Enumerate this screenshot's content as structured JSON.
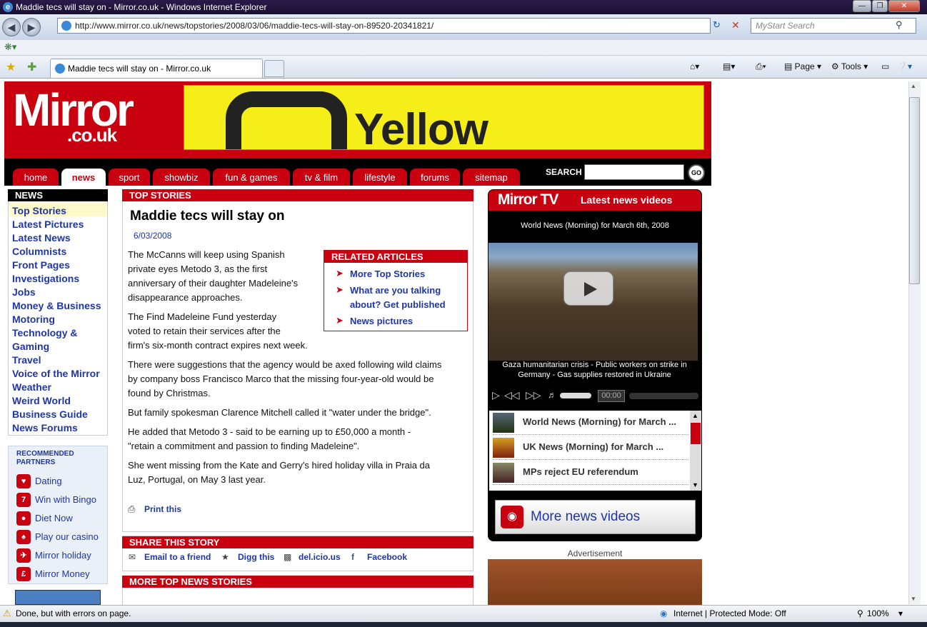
{
  "window": {
    "title": "Maddie tecs will stay on - Mirror.co.uk - Windows Internet Explorer",
    "url": "http://www.mirror.co.uk/news/topstories/2008/03/06/maddie-tecs-will-stay-on-89520-20341821/",
    "search_placeholder": "MyStart Search",
    "tab_title": "Maddie tecs will stay on - Mirror.co.uk",
    "toolbar": {
      "page": "Page",
      "tools": "Tools"
    }
  },
  "header": {
    "logo_main": "Mirror",
    "logo_sub": ".co.uk",
    "ad_text": "Yellow",
    "nav": [
      "home",
      "news",
      "sport",
      "showbiz",
      "fun & games",
      "tv & film",
      "lifestyle",
      "forums",
      "sitemap"
    ],
    "active_nav": "news",
    "search_label": "SEARCH",
    "go_label": "GO"
  },
  "left": {
    "header": "NEWS",
    "items": [
      "Top Stories",
      "Latest Pictures",
      "Latest News",
      "Columnists",
      "Front Pages",
      "Investigations",
      "Jobs",
      "Money & Business",
      "Motoring",
      "Technology &",
      "Gaming",
      "Travel",
      "Voice of the Mirror",
      "Weather",
      "Weird World",
      "Business Guide",
      "News Forums"
    ],
    "recommended_header_1": "RECOMMENDED",
    "recommended_header_2": "PARTNERS",
    "partners": [
      "Dating",
      "Win with Bingo",
      "Diet Now",
      "Play our casino",
      "Mirror holiday",
      "Mirror Money"
    ]
  },
  "article": {
    "section": "TOP STORIES",
    "title": "Maddie tecs will stay on",
    "date": "6/03/2008",
    "p1": [
      "The McCanns will keep using Spanish",
      "private eyes Metodo 3, as the first",
      "anniversary of their daughter Madeleine's",
      "disappearance approaches."
    ],
    "p2": [
      "The Find Madeleine Fund yesterday",
      "voted to retain their services after the",
      "firm's six-month contract expires next week."
    ],
    "p3": [
      "There were suggestions that the agency would be axed following wild claims",
      "by company boss Francisco Marco that the missing four-year-old would be",
      "found by Christmas."
    ],
    "p4": "But family spokesman Clarence Mitchell called it \"water under the bridge\".",
    "p5": [
      "He added that Metodo 3 - said to be earning up to £50,000 a month -",
      "\"retain a commitment and passion to finding Madeleine\"."
    ],
    "p6": [
      "She went missing from the Kate and Gerry's hired holiday villa in Praia da",
      "Luz, Portugal, on May 3 last year."
    ],
    "related_header": "RELATED ARTICLES",
    "related": [
      "More Top Stories",
      "What are you talking",
      "about? Get published",
      "News pictures"
    ],
    "print": "Print this",
    "share_header": "SHARE THIS STORY",
    "share": [
      "Email to a friend",
      "Digg this",
      "del.icio.us",
      "Facebook"
    ],
    "more_header": "MORE TOP NEWS STORIES"
  },
  "tv": {
    "logo": "Mirror TV",
    "latest": "Latest news videos",
    "caption": "World News (Morning) for March 6th, 2008",
    "video_caption": "Gaza humanitarian crisis - Public workers on strike in Germany - Gas supplies restored in Ukraine",
    "time": "00:00",
    "playlist": [
      "World News (Morning) for March ...",
      "UK News (Morning) for March ...",
      "MPs reject EU referendum"
    ],
    "more_videos": "More news videos",
    "advert_label": "Advertisement"
  },
  "status": {
    "text": "Done, but with errors on page.",
    "zone": "Internet | Protected Mode: Off",
    "zoom": "100%"
  }
}
